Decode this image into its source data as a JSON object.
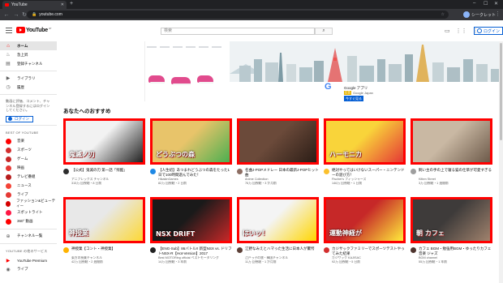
{
  "browser": {
    "tab_title": "YouTube",
    "new_tab_symbol": "+",
    "url": "youtube.com",
    "profile_label": "シークレット",
    "icons": [
      "back-icon",
      "forward-icon",
      "reload-icon",
      "lock-icon",
      "star-icon",
      "menu-icon"
    ]
  },
  "masthead": {
    "logo_text": "YouTube",
    "logo_region": "JP",
    "search_placeholder": "検索",
    "login_label": "ログイン",
    "icons": [
      "hamburger-icon",
      "search-icon",
      "video-camera-icon",
      "apps-icon",
      "more-icon",
      "user-circle-icon"
    ]
  },
  "sidebar": {
    "main_items": [
      {
        "label": "ホーム",
        "icon": "home-icon",
        "active": true
      },
      {
        "label": "急上昇",
        "icon": "trending-icon",
        "active": false
      },
      {
        "label": "登録チャンネル",
        "icon": "subscriptions-icon",
        "active": false
      }
    ],
    "library_items": [
      {
        "label": "ライブラリ",
        "icon": "library-icon"
      },
      {
        "label": "履歴",
        "icon": "history-icon"
      }
    ],
    "login_prompt": "動画に評価、コメント、チャンネル登録するにはログインしてください。",
    "login_label": "ログイン",
    "best_heading": "BEST OF YOUTUBE",
    "best_items": [
      {
        "label": "音楽",
        "color": "#ff0000"
      },
      {
        "label": "スポーツ",
        "color": "#d32f2f"
      },
      {
        "label": "ゲーム",
        "color": "#c62828"
      },
      {
        "label": "映画",
        "color": "#e53935"
      },
      {
        "label": "テレビ番組",
        "color": "#b71c1c"
      },
      {
        "label": "ニュース",
        "color": "#f44336"
      },
      {
        "label": "ライブ",
        "color": "#e53935"
      },
      {
        "label": "ファッション&ビューティー",
        "color": "#d50000"
      },
      {
        "label": "スポットライト",
        "color": "#ff1744"
      },
      {
        "label": "360° 動画",
        "color": "#ff0000"
      }
    ],
    "browse_channels": "チャンネル一覧",
    "services_heading": "YOUTUBE の他のサービス",
    "services_items": [
      {
        "label": "YouTube Premium",
        "icon": "youtube-premium-icon"
      },
      {
        "label": "ライブ",
        "icon": "live-icon"
      }
    ]
  },
  "banner": {
    "advertiser": "Google アプリ",
    "ad_badge": "広告",
    "ad_source": "Google Japan",
    "cta_label": "今すぐ見る",
    "logo": "G"
  },
  "section_title": "あなたへのおすすめ",
  "videos": [
    {
      "title": "【公式】鬼滅の刃 第一話「残酷」",
      "channel": "アニプレックス チャンネル",
      "stats": "315万 回視聴・8 日前",
      "avatar_color": "#2d2d2d",
      "thumb": [
        "#f2f2f2",
        "#222222"
      ],
      "thumb_text": "鬼滅ノ刃"
    },
    {
      "title": "【人生初】あつまれどうぶつの森をたった1日で100時間遊んでみた！",
      "channel": "HikakinGames",
      "stats": "82万 回視聴・2 日前",
      "avatar_color": "#1e88e5",
      "thumb": [
        "#e8c46a",
        "#4caf50"
      ],
      "thumb_text": "どうぶつの森"
    },
    {
      "title": "名曲J-POPメドレー 日本の最新J-POPヒット曲",
      "channel": "Anime Collection",
      "stats": "76万 回視聴・3 か月前",
      "avatar_color": "#8d6e63",
      "thumb": [
        "#6b4a3a",
        "#2b1d16"
      ],
      "thumb_text": ""
    },
    {
      "title": "絶対やってはいけないスーパー・ニンテンドーの遊び方！",
      "channel": "Fischer's フィッシャーズ",
      "stats": "146万 回視聴・1 日前",
      "avatar_color": "#fbc02d",
      "thumb": [
        "#f9d43a",
        "#e53935"
      ],
      "thumb_text": "ハーモニカ"
    },
    {
      "title": "飼い主の手の上で寝る猫の仕草が可愛すぎる",
      "channel": "Kitten Street",
      "stats": "3万 回視聴・1 週間前",
      "avatar_color": "#9e9e9e",
      "thumb": [
        "#c9b8a3",
        "#6d5a4a"
      ],
      "thumb_text": ""
    },
    {
      "title": "神授業【コント・神授業】",
      "channel": "東方の授業チャンネル",
      "stats": "42万 回視聴・2 週間前",
      "avatar_color": "#ffb300",
      "thumb": [
        "#e8e8e8",
        "#fdd835"
      ],
      "thumb_text": "神授業"
    },
    {
      "title": "【ENG-Sub】86バトル!! 新型NSX vs. ドリフトNSX-R【Hot-Version】2017",
      "channel": "Best MOTORing official ベストモータリング",
      "stats": "14万 回視聴・3 年前",
      "avatar_color": "#212121",
      "thumb": [
        "#1a1a1a",
        "#c62828"
      ],
      "thumb_text": "NSX DRIFT"
    },
    {
      "title": "江野なみえとハマった生活に日本人が驚愕",
      "channel": "江戸っ子の旅・韓国チャンネル",
      "stats": "11万 回視聴・1 か月前",
      "avatar_color": "#5d4037",
      "thumb": [
        "#f4f4f4",
        "#ffd600"
      ],
      "thumb_text": "はいッ！"
    },
    {
      "title": "カジサックファミリーでスポーツテストやってみた結果",
      "channel": "カジサック KAJISAC",
      "stats": "92万 回視聴・5 日前",
      "avatar_color": "#d32f2f",
      "thumb": [
        "#c62828",
        "#ffeb3b"
      ],
      "thumb_text": "運動神経が"
    },
    {
      "title": "カフェ BGM・勉強用BGM・ゆったりカフェ音楽 ジャズ",
      "channel": "BGM channel",
      "stats": "55万 回視聴・1 年前",
      "avatar_color": "#4e342e",
      "thumb": [
        "#3e3b3a",
        "#a0826d"
      ],
      "thumb_text": "朝 カフェ"
    }
  ]
}
